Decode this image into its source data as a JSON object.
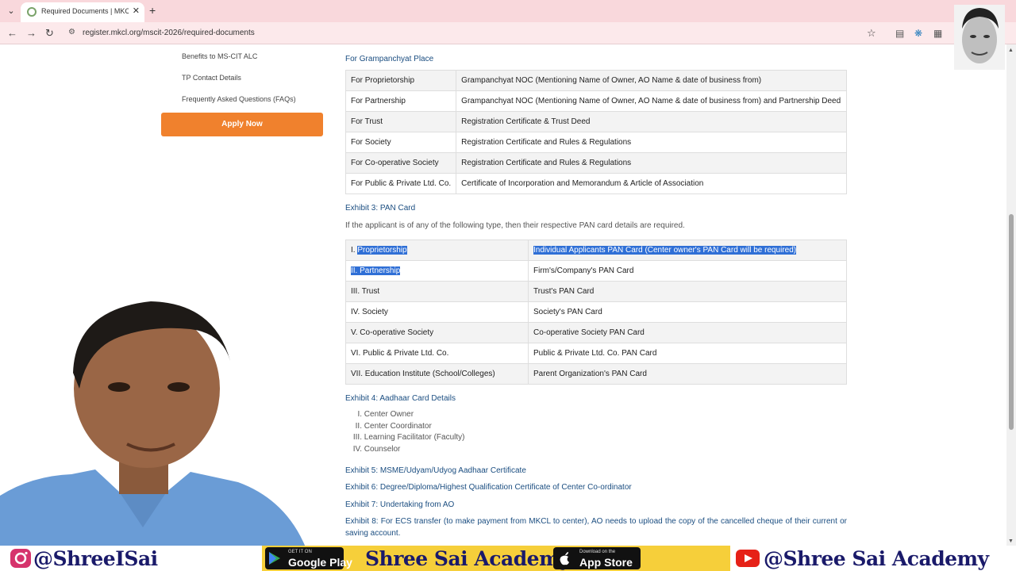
{
  "browser": {
    "tab_title": "Required Documents | MKCL Re",
    "url": "register.mkcl.org/mscit-2026/required-documents"
  },
  "sidebar": {
    "links": [
      "Benefits to MS-CIT ALC",
      "TP Contact Details",
      "Frequently Asked Questions (FAQs)"
    ],
    "apply_label": "Apply Now"
  },
  "grampanchayat": {
    "heading": "For Grampanchyat Place",
    "rows": [
      [
        "For Proprietorship",
        "Grampanchyat NOC (Mentioning Name of Owner, AO Name & date of business from)"
      ],
      [
        "For Partnership",
        "Grampanchyat NOC (Mentioning Name of Owner, AO Name & date of business from) and Partnership Deed"
      ],
      [
        "For Trust",
        "Registration Certificate & Trust Deed"
      ],
      [
        "For Society",
        "Registration Certificate and Rules & Regulations"
      ],
      [
        "For Co-operative Society",
        "Registration Certificate and Rules & Regulations"
      ],
      [
        "For Public & Private Ltd. Co.",
        "Certificate of Incorporation and Memorandum & Article of Association"
      ]
    ]
  },
  "pan": {
    "heading": "Exhibit 3: PAN Card",
    "note": "If the applicant is of any of the following type, then their respective PAN card details are required.",
    "rows": [
      [
        "I. ",
        "Proprietorship",
        "Individual Applicants PAN Card (Center owner's PAN Card will be required)"
      ],
      [
        "",
        "II. Partnership",
        "Firm's/Company's PAN Card"
      ],
      [
        "",
        "III. Trust",
        "Trust's PAN Card"
      ],
      [
        "",
        "IV. Society",
        "Society's PAN Card"
      ],
      [
        "",
        "V. Co-operative Society",
        "Co-operative Society PAN Card"
      ],
      [
        "",
        "VI. Public & Private Ltd. Co.",
        "Public & Private Ltd. Co. PAN Card"
      ],
      [
        "",
        "VII. Education Institute (School/Colleges)",
        "Parent Organization's PAN Card"
      ]
    ]
  },
  "aadhaar": {
    "heading": "Exhibit 4: Aadhaar Card Details",
    "items": [
      {
        "num": "I.",
        "label": "Center Owner"
      },
      {
        "num": "II.",
        "label": "Center Coordinator"
      },
      {
        "num": "III.",
        "label": "Learning Facilitator (Faculty)"
      },
      {
        "num": "IV.",
        "label": "Counselor"
      }
    ]
  },
  "exhibits": {
    "ex5": "Exhibit 5: MSME/Udyam/Udyog Aadhaar Certificate",
    "ex6": "Exhibit 6: Degree/Diploma/Highest Qualification Certificate of Center Co-ordinator",
    "ex7": "Exhibit 7: Undertaking from AO",
    "ex8": "Exhibit 8: For ECS transfer (to make payment from MKCL to center), AO needs to upload the copy of the cancelled cheque of their current or saving account."
  },
  "banner": {
    "instagram": "@ShreeISai",
    "google_small": "GET IT ON",
    "google_big": "Google Play",
    "brand": "Shree Sai Academy",
    "apple_small": "Download on the",
    "apple_big": "App Store",
    "youtube": "@Shree Sai Academy"
  },
  "colors": {
    "accent_orange": "#f0812d",
    "link_blue": "#1a4d80",
    "selection": "#2f6fd6",
    "banner_yellow": "#f6cf3a"
  }
}
